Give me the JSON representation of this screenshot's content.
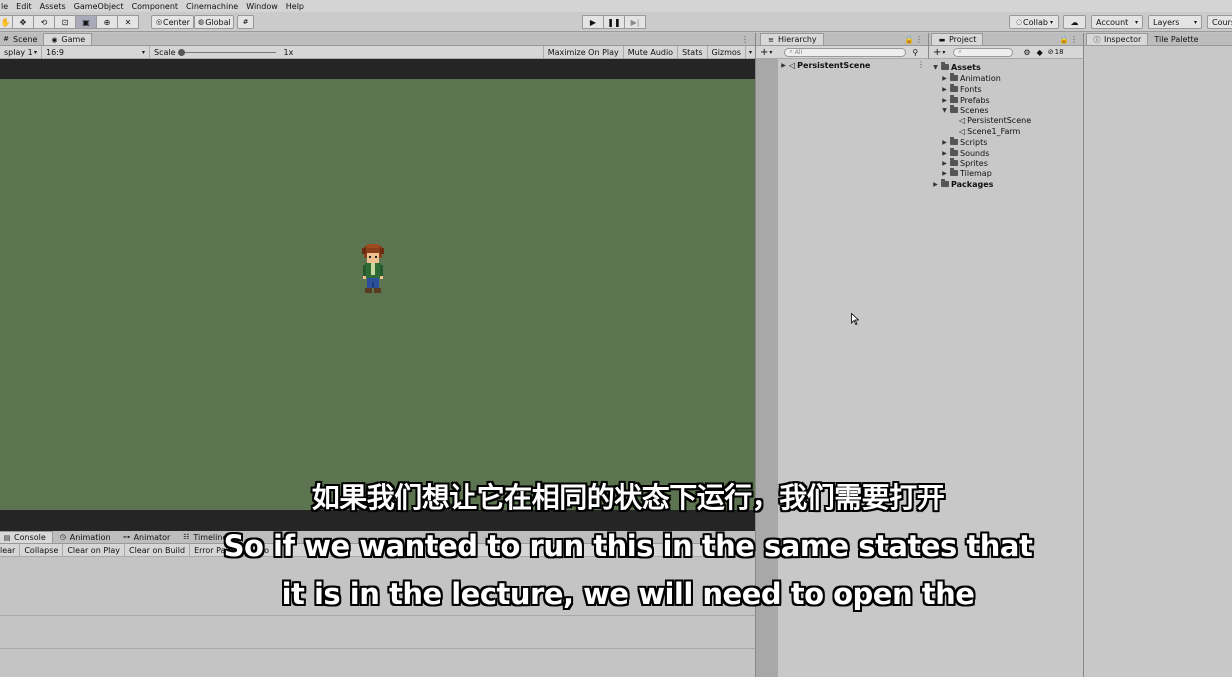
{
  "menu": [
    "le",
    "Edit",
    "Assets",
    "GameObject",
    "Component",
    "Cinemachine",
    "Window",
    "Help"
  ],
  "toolbar": {
    "pivot_label": "Center",
    "space_label": "Global",
    "collab_label": "Collab",
    "account_label": "Account",
    "layers_label": "Layers",
    "layout_label": "Cours"
  },
  "game_panel": {
    "tabs": [
      "Scene",
      "Game"
    ],
    "display_label": "splay 1",
    "aspect_label": "16:9",
    "scale_label": "Scale",
    "scale_value": "1x",
    "maximize_label": "Maximize On Play",
    "mute_label": "Mute Audio",
    "stats_label": "Stats",
    "gizmos_label": "Gizmos"
  },
  "console_panel": {
    "tabs": [
      "Console",
      "Animation",
      "Animator",
      "Timeline"
    ],
    "buttons": [
      "lear",
      "Collapse",
      "Clear on Play",
      "Clear on Build",
      "Error Pause",
      "Edito"
    ]
  },
  "hierarchy": {
    "tab": "Hierarchy",
    "search_placeholder": "All",
    "scene_item": "PersistentScene"
  },
  "project": {
    "tab": "Project",
    "count": "18",
    "root": "Assets",
    "folders": [
      "Animation",
      "Fonts",
      "Prefabs",
      "Scenes",
      "Scripts",
      "Sounds",
      "Sprites",
      "Tilemap"
    ],
    "scenes": [
      "PersistentScene",
      "Scene1_Farm"
    ],
    "packages": "Packages"
  },
  "inspector": {
    "tabs": [
      "Inspector",
      "Tile Palette"
    ]
  },
  "subtitles": {
    "zh": "如果我们想让它在相同的状态下运行，我们需要打开",
    "en1": "So if we wanted to run this in the same states that",
    "en2": "it is in the lecture, we will need to open the"
  },
  "colors": {
    "game_background": "#5d7451",
    "letterbox": "#252525"
  }
}
